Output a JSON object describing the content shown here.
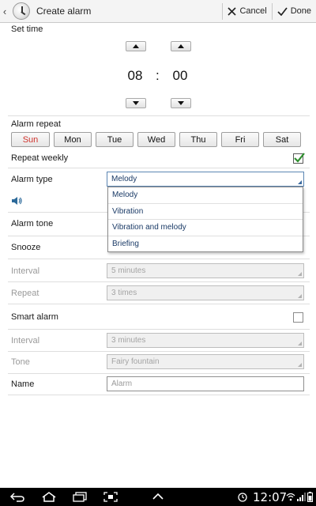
{
  "header": {
    "title": "Create alarm",
    "cancel_label": "Cancel",
    "done_label": "Done"
  },
  "time": {
    "section_label": "Set time",
    "hour": "08",
    "separator": ":",
    "minute": "00"
  },
  "repeat": {
    "label": "Alarm repeat",
    "days": [
      "Sun",
      "Mon",
      "Tue",
      "Wed",
      "Thu",
      "Fri",
      "Sat"
    ],
    "selected_day": "Sun",
    "weekly_label": "Repeat weekly",
    "weekly_checked": true
  },
  "alarm_type": {
    "label": "Alarm type",
    "value": "Melody",
    "options": [
      "Melody",
      "Vibration",
      "Vibration and melody",
      "Briefing"
    ]
  },
  "alarm_tone": {
    "label": "Alarm tone"
  },
  "snooze": {
    "label": "Snooze",
    "interval_label": "Interval",
    "interval_value": "5 minutes",
    "repeat_label": "Repeat",
    "repeat_value": "3 times"
  },
  "smart_alarm": {
    "label": "Smart alarm",
    "checked": false,
    "interval_label": "Interval",
    "interval_value": "3 minutes",
    "tone_label": "Tone",
    "tone_value": "Fairy fountain"
  },
  "name": {
    "label": "Name",
    "placeholder": "Alarm"
  },
  "status_bar": {
    "time": "12:07"
  },
  "colors": {
    "selected_day": "#d0332d",
    "checkbox_check": "#2f8f2f",
    "accent": "#3b6aa0"
  }
}
